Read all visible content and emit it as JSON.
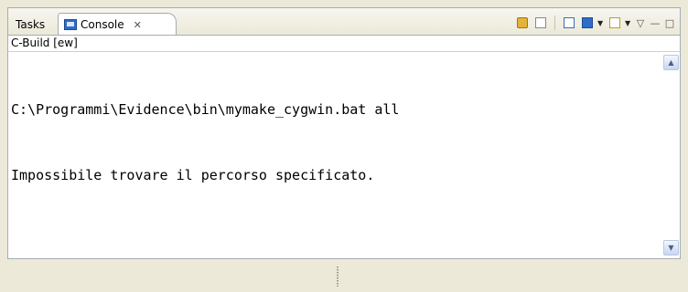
{
  "tabs": [
    {
      "label": "Tasks"
    },
    {
      "label": "Console",
      "close": "✕"
    }
  ],
  "toolbar": {
    "icons": [
      "lock-icon",
      "clear-console-icon",
      "new-console-icon",
      "pin-console-icon",
      "open-console-icon"
    ],
    "view_menu": "▽",
    "minimize": "—",
    "maximize": "□"
  },
  "console": {
    "title": "C-Build [ew]",
    "lines": [
      "C:\\Programmi\\Evidence\\bin\\mymake_cygwin.bat all",
      "Impossibile trovare il percorso specificato."
    ]
  },
  "scroll": {
    "up": "▲",
    "down": "▼"
  },
  "colors": {
    "panel_bg": "#ece9d8",
    "border": "#a5acb5",
    "icon_blue": "#2f6dc7"
  }
}
